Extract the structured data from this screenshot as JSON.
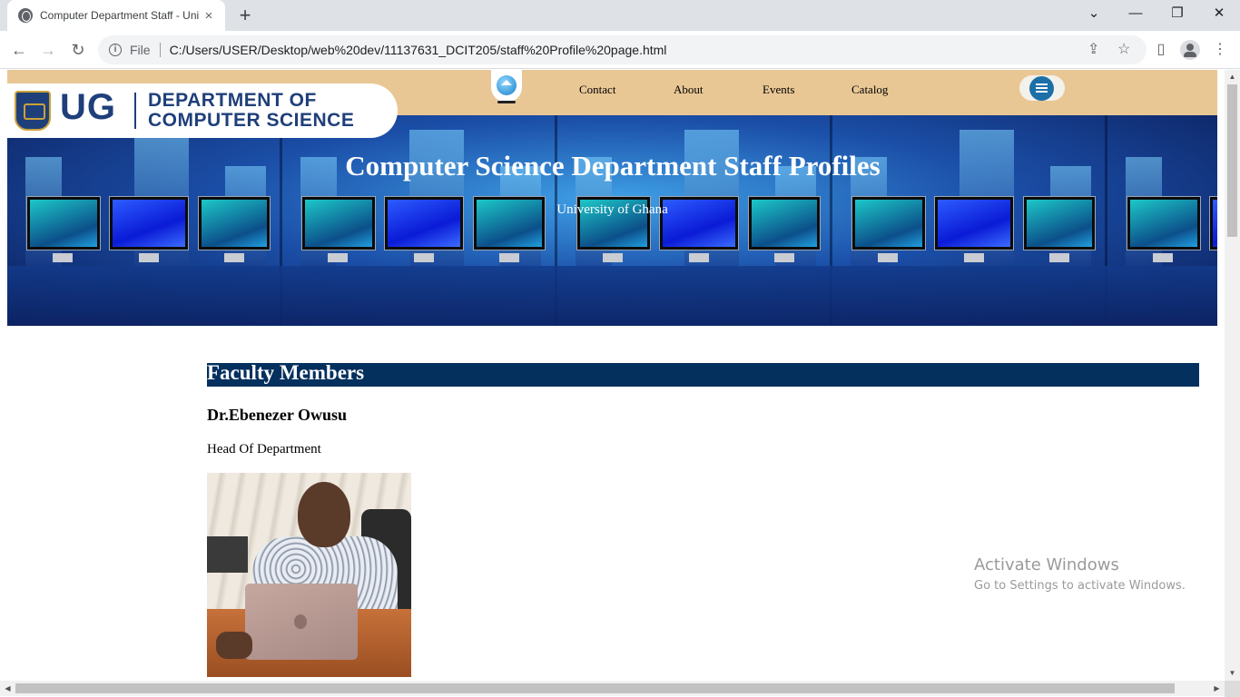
{
  "browser": {
    "tab_title": "Computer Department Staff - University of Ghana",
    "tab_close": "×",
    "new_tab": "+",
    "window_min": "—",
    "window_restore": "❐",
    "window_close": "✕",
    "window_list": "⌄",
    "back": "←",
    "forward": "→",
    "reload": "↻",
    "info": "i",
    "file_label": "File",
    "url": "C:/Users/USER/Desktop/web%20dev/11137631_DCIT205/staff%20Profile%20page.html",
    "share": "⇪",
    "bookmark": "☆",
    "sidepanel": "▯",
    "menu": "⋮"
  },
  "site": {
    "logo": {
      "ug": "UG",
      "line1": "DEPARTMENT OF",
      "line2": "COMPUTER SCIENCE"
    },
    "nav": [
      {
        "label": "Contact"
      },
      {
        "label": "About"
      },
      {
        "label": "Events"
      },
      {
        "label": "Catalog"
      }
    ],
    "banner": {
      "title": "Computer Science Department Staff Profiles",
      "subtitle": "University of Ghana"
    }
  },
  "content": {
    "section_title": "Faculty Members",
    "staff": [
      {
        "name": "Dr.Ebenezer Owusu",
        "role": "Head Of Department"
      }
    ]
  },
  "os": {
    "watermark_line1": "Activate Windows",
    "watermark_line2": "Go to Settings to activate Windows."
  },
  "colors": {
    "nav_bar": "#e9c795",
    "section_bar": "#04305e",
    "brand_blue": "#1f3f7a"
  }
}
